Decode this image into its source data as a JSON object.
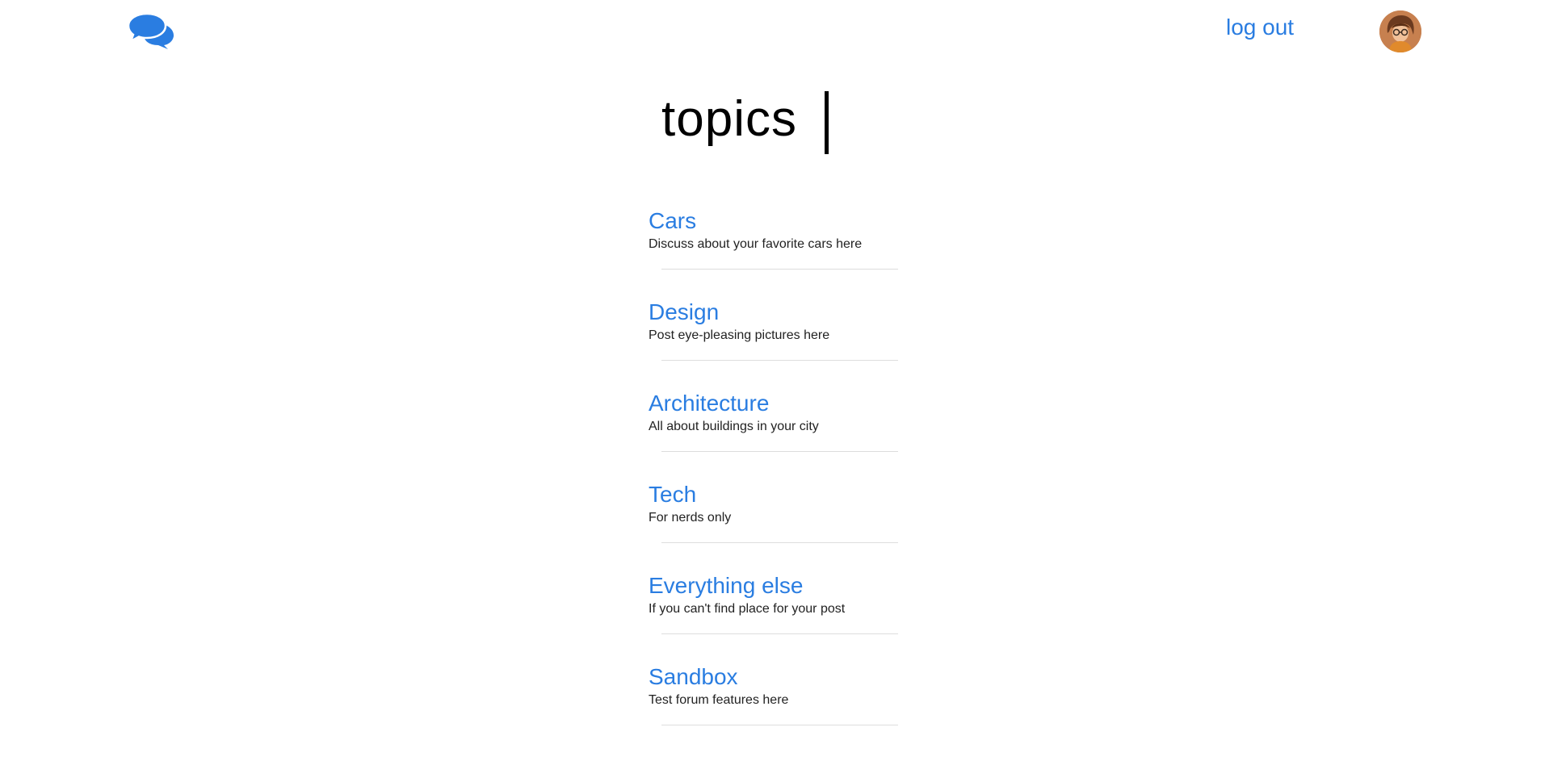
{
  "header": {
    "logo_icon": "chat-bubbles-icon",
    "logout_label": "log out",
    "avatar_icon": "user-avatar",
    "accent_color": "#2a7de1"
  },
  "main": {
    "title": "topics"
  },
  "topics": [
    {
      "name": "Cars",
      "description": "Discuss about your favorite cars here"
    },
    {
      "name": "Design",
      "description": "Post eye-pleasing pictures here"
    },
    {
      "name": "Architecture",
      "description": "All about buildings in your city"
    },
    {
      "name": "Tech",
      "description": "For nerds only"
    },
    {
      "name": "Everything else",
      "description": "If you can't find place for your post"
    },
    {
      "name": "Sandbox",
      "description": "Test forum features here"
    }
  ]
}
